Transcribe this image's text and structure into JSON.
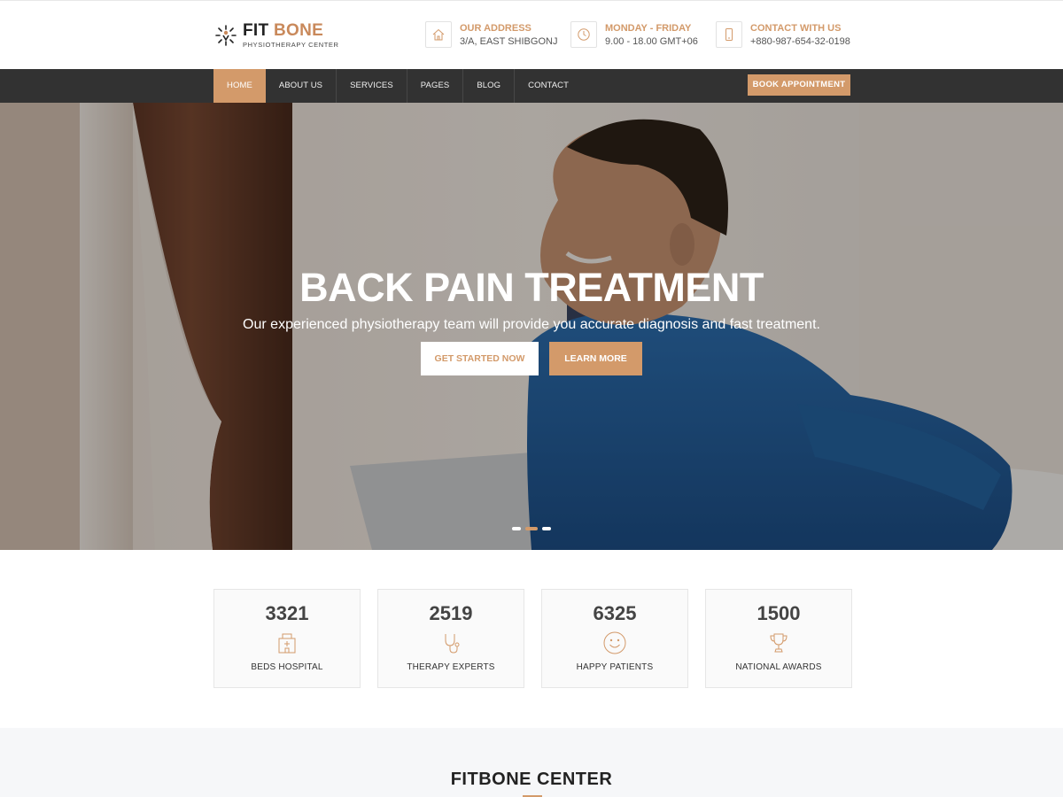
{
  "brand": {
    "name_part1": "FIT",
    "name_part2": "BONE",
    "subtitle": "PHYSIOTHERAPY CENTER"
  },
  "header_info": [
    {
      "icon": "home-icon",
      "title": "OUR ADDRESS",
      "text": "3/A, EAST SHIBGONJ"
    },
    {
      "icon": "clock-icon",
      "title": "MONDAY - FRIDAY",
      "text": "9.00 - 18.00 GMT+06"
    },
    {
      "icon": "phone-icon",
      "title": "CONTACT WITH US",
      "text": "+880-987-654-32-0198"
    }
  ],
  "nav": {
    "items": [
      "HOME",
      "ABOUT US",
      "SERVICES",
      "PAGES",
      "BLOG",
      "CONTACT"
    ],
    "active": "HOME",
    "cta": "BOOK APPOINTMENT"
  },
  "hero": {
    "title": "BACK PAIN TREATMENT",
    "subtitle": "Our experienced physiotherapy team will provide you accurate diagnosis and fast treatment.",
    "primary_button": "GET STARTED NOW",
    "secondary_button": "LEARN MORE",
    "slides": 3,
    "active_slide": 2
  },
  "stats": [
    {
      "value": "3321",
      "label": "BEDS HOSPITAL",
      "icon": "hospital-icon"
    },
    {
      "value": "2519",
      "label": "THERAPY EXPERTS",
      "icon": "stethoscope-icon"
    },
    {
      "value": "6325",
      "label": "HAPPY PATIENTS",
      "icon": "smiley-icon"
    },
    {
      "value": "1500",
      "label": "NATIONAL AWARDS",
      "icon": "trophy-icon"
    }
  ],
  "section": {
    "title": "FITBONE CENTER"
  },
  "colors": {
    "accent": "#d39a6a",
    "nav_bg": "#323232",
    "dark_text": "#222222"
  }
}
